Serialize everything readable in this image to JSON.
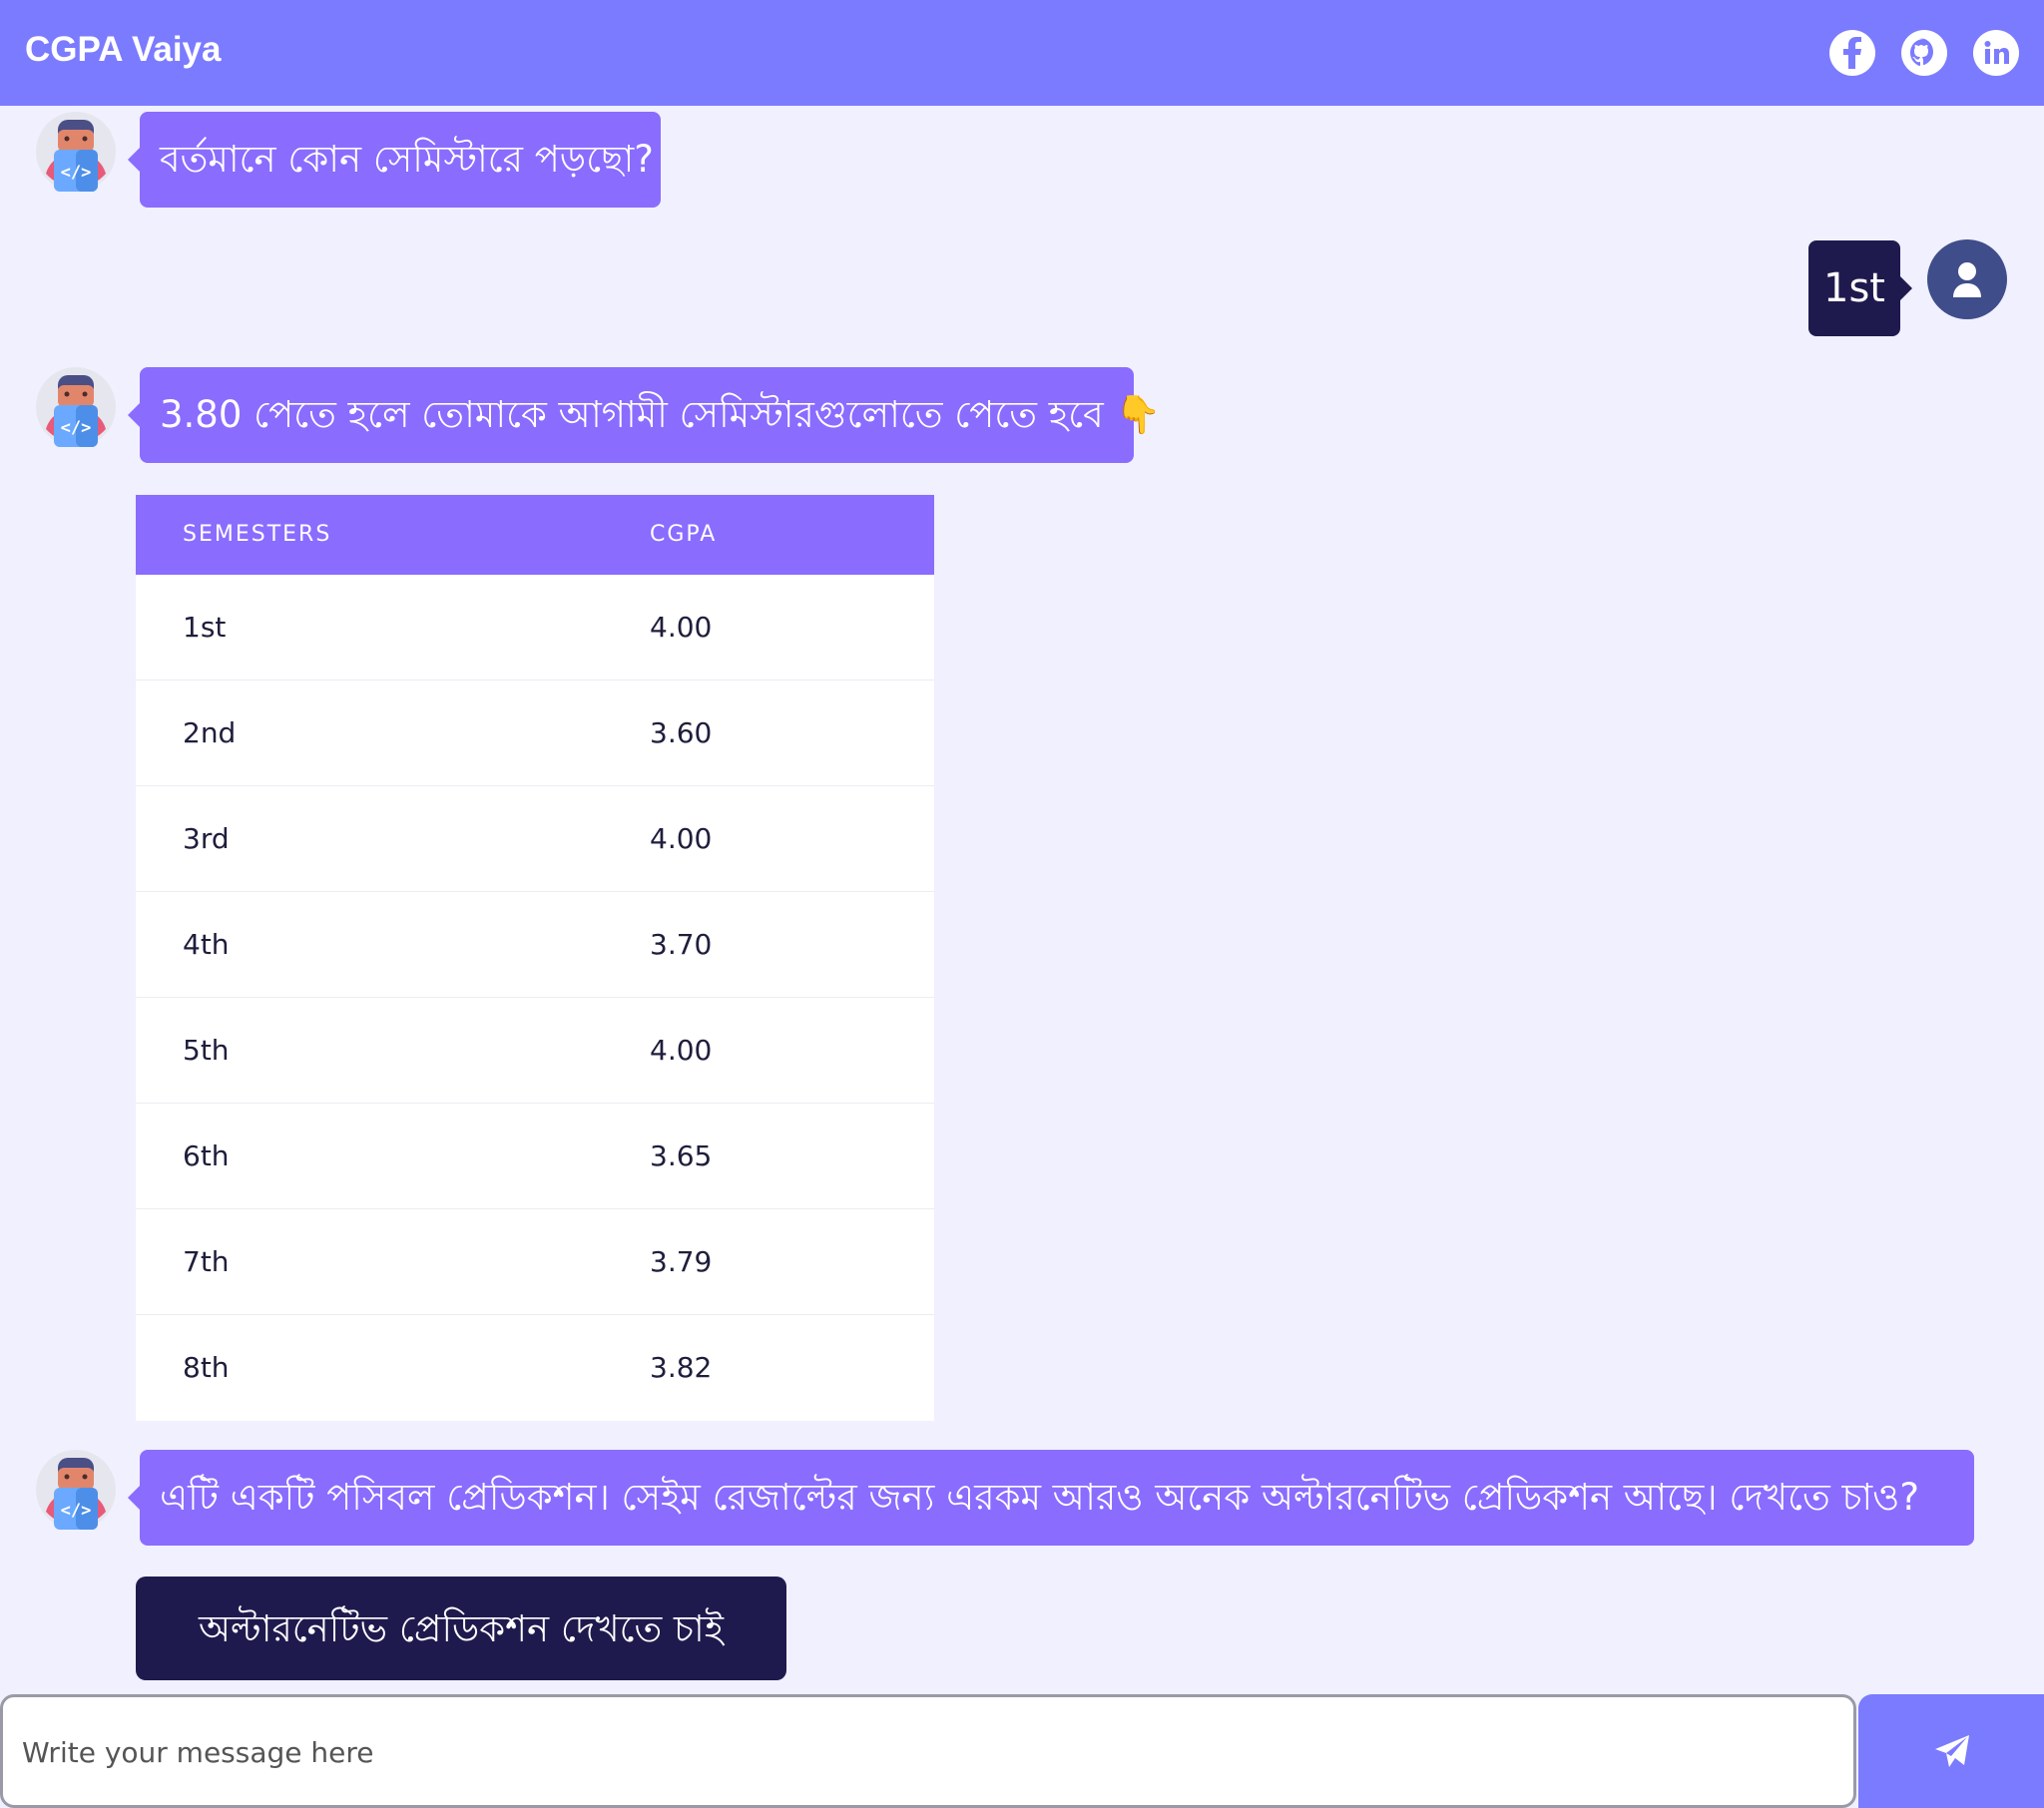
{
  "header": {
    "title": "CGPA Vaiya",
    "social": [
      {
        "name": "facebook-icon"
      },
      {
        "name": "github-icon"
      },
      {
        "name": "linkedin-icon"
      }
    ]
  },
  "chat": {
    "bot_messages": [
      "বর্তমানে কোন সেমিস্টারে পড়ছো?",
      "3.80 পেতে হলে তোমাকে আগামী সেমিস্টারগুলোতে পেতে হবে 👇",
      "এটি একটি পসিবল প্রেডিকশন। সেইম রেজাল্টের জন্য এরকম আরও অনেক অল্টারনেটিভ প্রেডিকশন আছে। দেখতে চাও?"
    ],
    "user_message": "1st"
  },
  "table": {
    "headers": [
      "SEMESTERS",
      "CGPA"
    ],
    "rows": [
      [
        "1st",
        "4.00"
      ],
      [
        "2nd",
        "3.60"
      ],
      [
        "3rd",
        "4.00"
      ],
      [
        "4th",
        "3.70"
      ],
      [
        "5th",
        "4.00"
      ],
      [
        "6th",
        "3.65"
      ],
      [
        "7th",
        "3.79"
      ],
      [
        "8th",
        "3.82"
      ]
    ]
  },
  "option_button": "অল্টারনেটিভ প্রেডিকশন দেখতে চাই",
  "composer": {
    "placeholder": "Write your message here",
    "value": ""
  },
  "colors": {
    "header_bg": "#7b7bff",
    "bot_bubble": "#8a6cff",
    "user_bubble": "#1f1a4e",
    "page_bg": "#f0f0ff"
  }
}
